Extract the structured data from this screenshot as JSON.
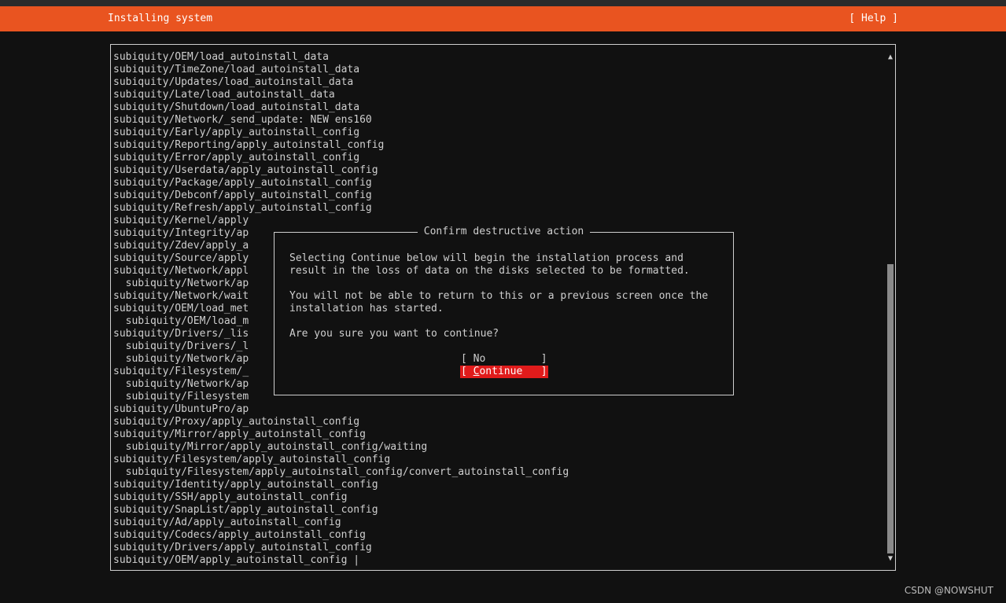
{
  "header": {
    "title": "Installing system",
    "help_label": "[ Help ]"
  },
  "log": {
    "lines": [
      "subiquity/OEM/load_autoinstall_data",
      "subiquity/TimeZone/load_autoinstall_data",
      "subiquity/Updates/load_autoinstall_data",
      "subiquity/Late/load_autoinstall_data",
      "subiquity/Shutdown/load_autoinstall_data",
      "subiquity/Network/_send_update: NEW ens160",
      "subiquity/Early/apply_autoinstall_config",
      "subiquity/Reporting/apply_autoinstall_config",
      "subiquity/Error/apply_autoinstall_config",
      "subiquity/Userdata/apply_autoinstall_config",
      "subiquity/Package/apply_autoinstall_config",
      "subiquity/Debconf/apply_autoinstall_config",
      "subiquity/Refresh/apply_autoinstall_config",
      "subiquity/Kernel/apply",
      "subiquity/Integrity/ap",
      "subiquity/Zdev/apply_a",
      "subiquity/Source/apply",
      "subiquity/Network/appl",
      "  subiquity/Network/ap",
      "subiquity/Network/wait",
      "subiquity/OEM/load_met",
      "  subiquity/OEM/load_m",
      "subiquity/Drivers/_lis",
      "  subiquity/Drivers/_l",
      "  subiquity/Network/ap",
      "subiquity/Filesystem/_",
      "  subiquity/Network/ap",
      "  subiquity/Filesystem",
      "subiquity/UbuntuPro/ap",
      "subiquity/Proxy/apply_autoinstall_config",
      "subiquity/Mirror/apply_autoinstall_config",
      "  subiquity/Mirror/apply_autoinstall_config/waiting",
      "subiquity/Filesystem/apply_autoinstall_config",
      "  subiquity/Filesystem/apply_autoinstall_config/convert_autoinstall_config",
      "subiquity/Identity/apply_autoinstall_config",
      "subiquity/SSH/apply_autoinstall_config",
      "subiquity/SnapList/apply_autoinstall_config",
      "subiquity/Ad/apply_autoinstall_config",
      "subiquity/Codecs/apply_autoinstall_config",
      "subiquity/Drivers/apply_autoinstall_config",
      "subiquity/OEM/apply_autoinstall_config |"
    ],
    "scroll_up_icon": "▲",
    "scroll_down_icon": "▼"
  },
  "dialog": {
    "title": "Confirm destructive action",
    "line1": "Selecting Continue below will begin the installation process and",
    "line2": "result in the loss of data on the disks selected to be formatted.",
    "line3": "You will not be able to return to this or a previous screen once the",
    "line4": "installation has started.",
    "question": "Are you sure you want to continue?",
    "no_label": "[ No         ]",
    "continue_open": "[ ",
    "continue_first": "C",
    "continue_rest": "ontinue   ]"
  },
  "watermark": "CSDN @NOWSHUT",
  "colors": {
    "accent": "#e95420",
    "background": "#111111",
    "button_focus": "#e01b1b"
  }
}
